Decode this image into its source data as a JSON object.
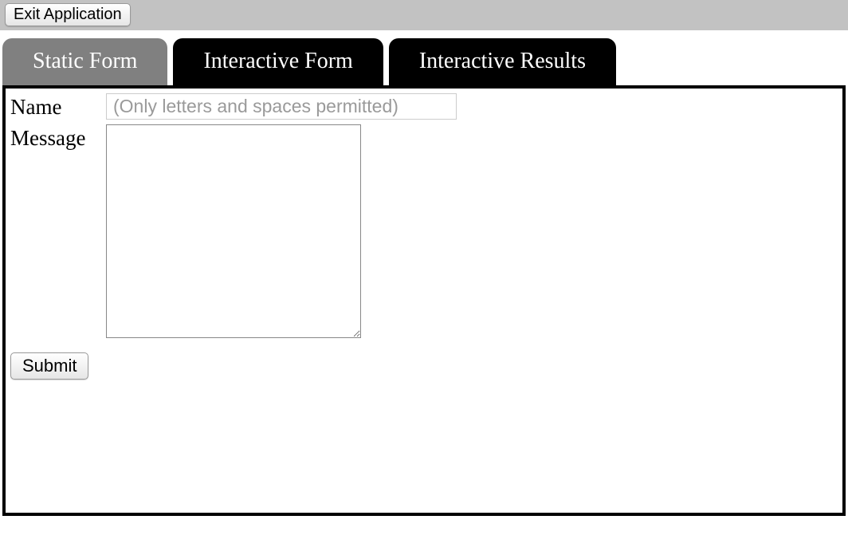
{
  "topbar": {
    "exit_label": "Exit Application"
  },
  "tabs": [
    {
      "label": "Static Form",
      "active": true
    },
    {
      "label": "Interactive Form",
      "active": false
    },
    {
      "label": "Interactive Results",
      "active": false
    }
  ],
  "form": {
    "name_label": "Name",
    "name_placeholder": "(Only letters and spaces permitted)",
    "name_value": "",
    "message_label": "Message",
    "message_value": "",
    "submit_label": "Submit"
  }
}
